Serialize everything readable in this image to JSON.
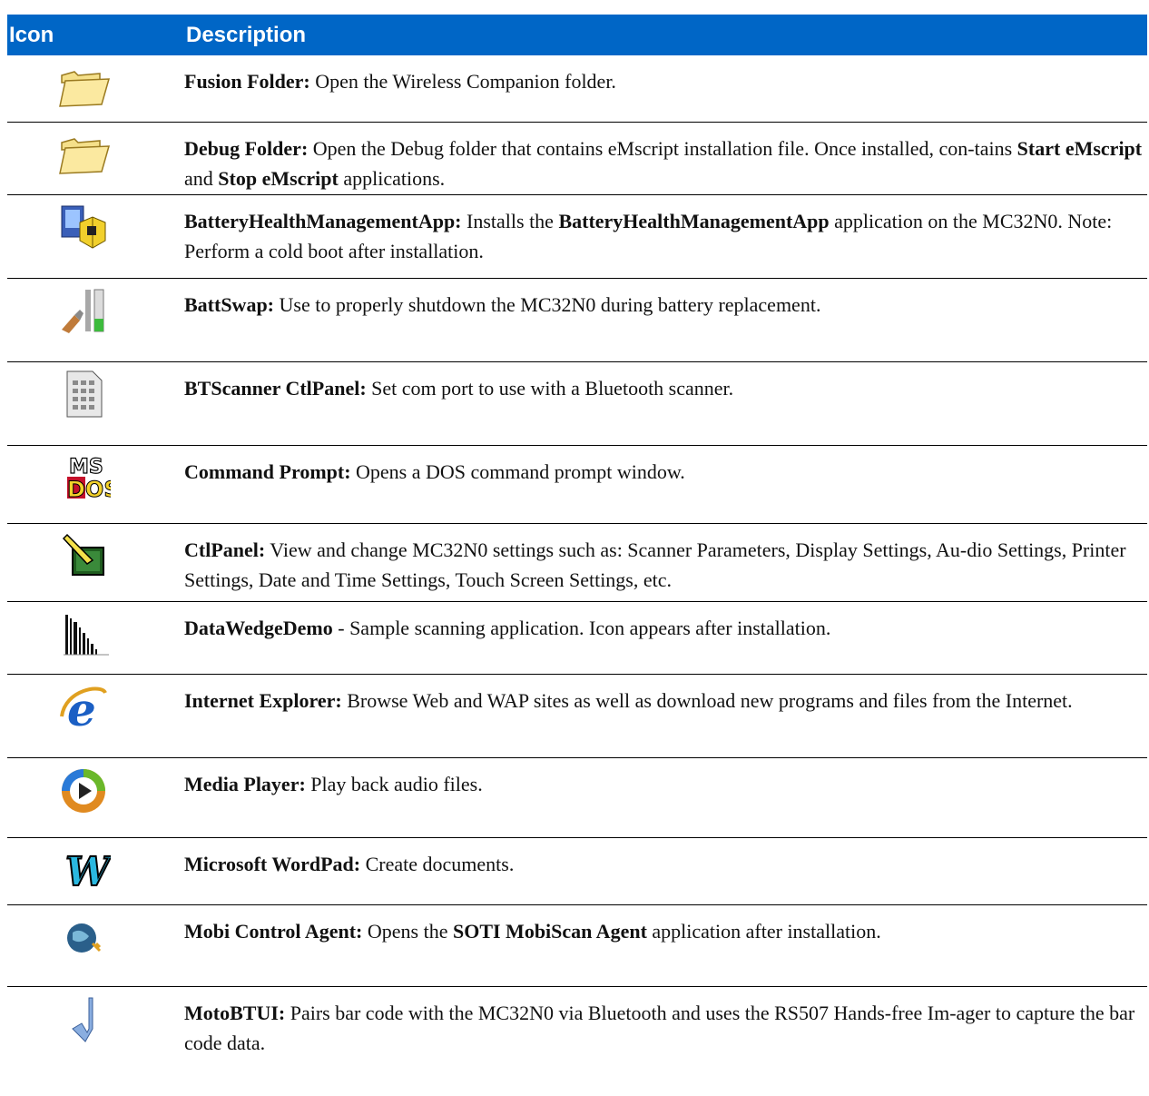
{
  "table": {
    "headers": {
      "icon": "Icon",
      "description": "Description"
    },
    "rows": [
      {
        "icon": "folder-icon",
        "parts": [
          {
            "b": "Fusion Folder:"
          },
          {
            "t": " Open the Wireless Companion folder."
          }
        ]
      },
      {
        "icon": "folder-icon",
        "parts": [
          {
            "b": "Debug Folder:"
          },
          {
            "t": " Open the Debug folder that contains eMscript installation file. Once installed, con-tains "
          },
          {
            "b": "Start eMscript"
          },
          {
            "t": " and "
          },
          {
            "b": "Stop eMscript"
          },
          {
            "t": " applications."
          }
        ]
      },
      {
        "icon": "battery-health-install-icon",
        "parts": [
          {
            "b": "BatteryHealthManagementApp:"
          },
          {
            "t": " Installs the "
          },
          {
            "b": "BatteryHealthManagementApp"
          },
          {
            "t": " application on the MC32N0. Note: Perform a cold boot after installation."
          }
        ]
      },
      {
        "icon": "battswap-icon",
        "parts": [
          {
            "b": "BattSwap:"
          },
          {
            "t": " Use to properly shutdown the MC32N0 during battery replacement."
          }
        ]
      },
      {
        "icon": "btscanner-icon",
        "parts": [
          {
            "b": "BTScanner CtlPanel:"
          },
          {
            "t": " Set com port to use with a Bluetooth scanner."
          }
        ]
      },
      {
        "icon": "msdos-icon",
        "parts": [
          {
            "b": "Command Prompt:"
          },
          {
            "t": " Opens a DOS command prompt window."
          }
        ]
      },
      {
        "icon": "control-panel-icon",
        "parts": [
          {
            "b": "CtlPanel:"
          },
          {
            "t": " View and change MC32N0 settings such as: Scanner Parameters, Display Settings, Au-dio Settings, Printer Settings, Date and Time Settings, Touch Screen Settings, etc."
          }
        ]
      },
      {
        "icon": "barcode-icon",
        "parts": [
          {
            "b": "DataWedgeDemo"
          },
          {
            "t": " - Sample scanning application. Icon appears after installation."
          }
        ]
      },
      {
        "icon": "internet-explorer-icon",
        "parts": [
          {
            "b": "Internet Explorer:"
          },
          {
            "t": " Browse Web and WAP sites as well as download new programs and files from the Internet."
          }
        ]
      },
      {
        "icon": "media-player-icon",
        "parts": [
          {
            "b": "Media Player:"
          },
          {
            "t": " Play back audio files."
          }
        ]
      },
      {
        "icon": "wordpad-icon",
        "parts": [
          {
            "b": "Microsoft WordPad:"
          },
          {
            "t": " Create documents."
          }
        ]
      },
      {
        "icon": "mobi-control-icon",
        "parts": [
          {
            "b": "Mobi Control Agent:"
          },
          {
            "t": " Opens the "
          },
          {
            "b": "SOTI MobiScan Agent"
          },
          {
            "t": " application after installation."
          }
        ]
      },
      {
        "icon": "motobtui-icon",
        "parts": [
          {
            "b": "MotoBTUI:"
          },
          {
            "t": " Pairs bar code with the MC32N0 via Bluetooth and uses the RS507 Hands-free Im-ager to capture the bar code data."
          }
        ]
      }
    ]
  }
}
